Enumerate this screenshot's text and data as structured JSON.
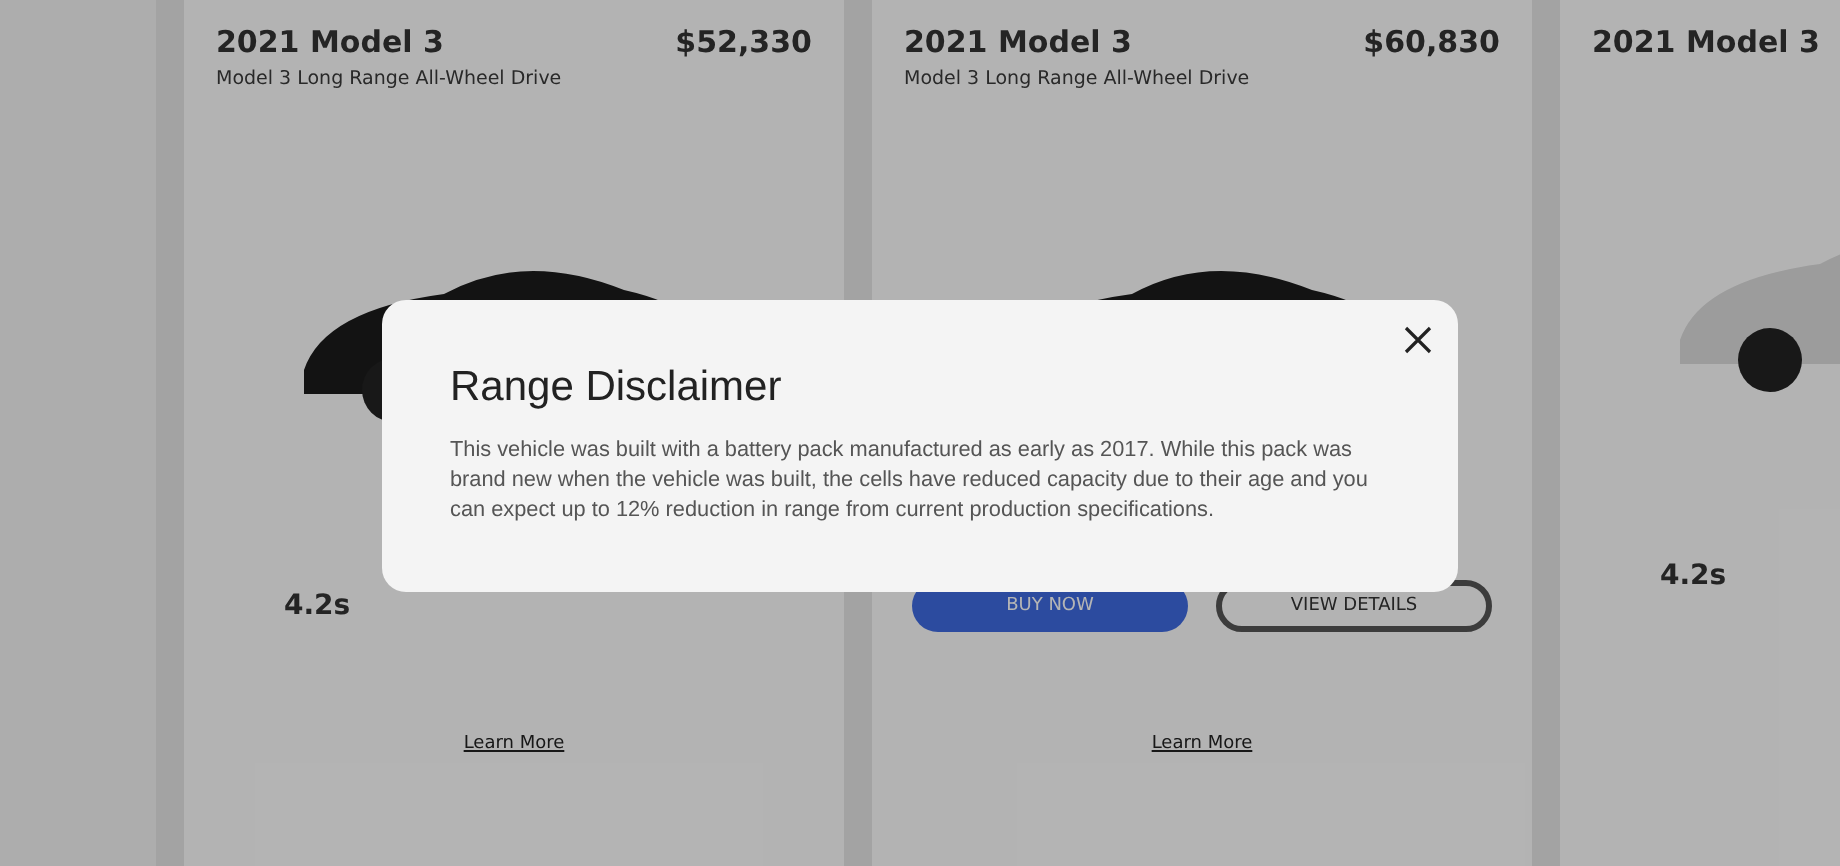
{
  "cards": [
    {
      "title": "2021 Model 3",
      "subtitle": "Model 3 Long Range All-Wheel Drive",
      "price": "$52,330",
      "kind": "stats",
      "stats": [
        "4.2s"
      ],
      "link": "Learn More"
    },
    {
      "title": "2021 Model 3",
      "subtitle": "Model 3 Long Range All-Wheel Drive",
      "price": "$60,830",
      "kind": "actions",
      "buttons": [
        "BUY NOW",
        "VIEW DETAILS"
      ],
      "link": "Learn More"
    },
    {
      "title": "2021 Model 3",
      "kind": "stats",
      "stats": [
        "4.2s"
      ]
    }
  ],
  "modal": {
    "title": "Range Disclaimer",
    "body": "This vehicle was built with a battery pack manufactured as early as 2017. While this pack was brand new when the vehicle was built, the cells have reduced capacity due to their age and you can expect up to 12% reduction in range from current production specifications."
  }
}
